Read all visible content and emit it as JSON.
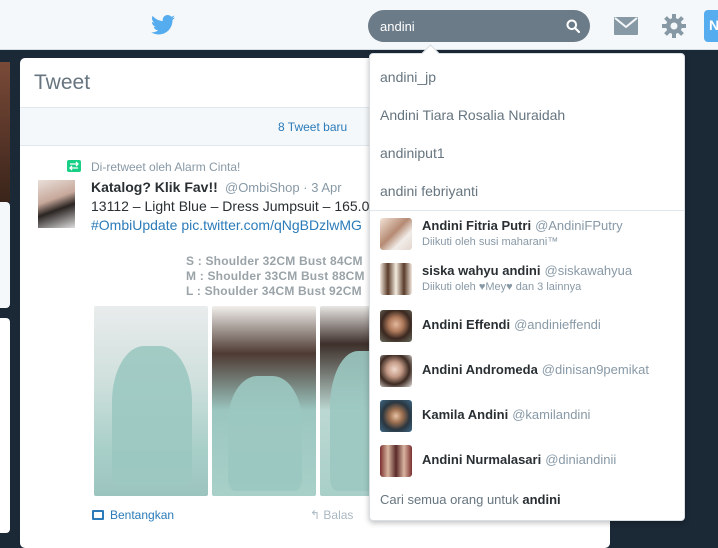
{
  "colors": {
    "brand": "#55acee",
    "link": "#2b7bb9",
    "muted": "#8899a6",
    "text": "#292f33",
    "retweet": "#19cf86"
  },
  "topbar": {
    "logo_icon": "twitter-bird-icon",
    "search": {
      "value": "andini",
      "icon": "search-icon"
    },
    "messages_icon": "envelope-icon",
    "settings_icon": "gear-icon",
    "compose_label": "N"
  },
  "stream": {
    "title": "Tweet",
    "new_tweets": "8 Tweet baru",
    "tweet": {
      "retweet_by": "Di-retweet oleh Alarm Cinta!",
      "author_name": "Katalog? Klik Fav!!",
      "author_handle": "@OmbiShop",
      "time": "· 3 Apr",
      "text_line1": "13112 – Light Blue – Dress Jumpsuit – 165.0",
      "hashtag": "#OmbiUpdate",
      "link": "pic.twitter.com/qNgBDzlwMG",
      "media_text": [
        "S : Shoulder 32CM Bust 84CM",
        "M : Shoulder 33CM Bust 88CM",
        "L : Shoulder 34CM Bust 92CM"
      ],
      "expand_label": "Bentangkan",
      "reply_label": "Balas"
    }
  },
  "dropdown": {
    "queries": [
      "andini_jp",
      "Andini Tiara Rosalia Nuraidah",
      "andiniput1",
      "andini febriyanti"
    ],
    "users": [
      {
        "name": "Andini Fitria Putri",
        "handle": "@AndiniFPutry",
        "sub": "Diikuti oleh susi maharani™"
      },
      {
        "name": "siska wahyu andini",
        "handle": "@siskawahyua",
        "sub": "Diikuti oleh ♥Mey♥ dan 3 lainnya"
      },
      {
        "name": "Andini Effendi",
        "handle": "@andinieffendi",
        "sub": ""
      },
      {
        "name": "Andini Andromeda",
        "handle": "@dinisan9pemikat",
        "sub": ""
      },
      {
        "name": "Kamila Andini",
        "handle": "@kamilandini",
        "sub": ""
      },
      {
        "name": "Andini Nurmalasari",
        "handle": "@diniandinii",
        "sub": ""
      }
    ],
    "search_all_prefix": "Cari semua orang untuk",
    "search_all_term": "andini"
  }
}
